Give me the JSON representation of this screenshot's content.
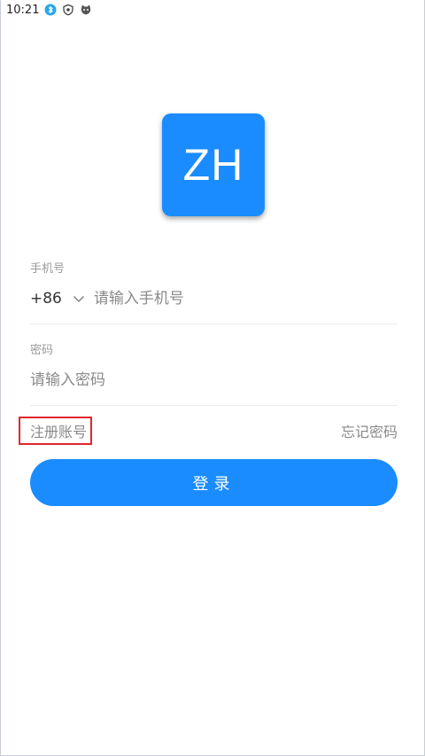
{
  "statusbar": {
    "time": "10:21",
    "icons": [
      "bluetooth-icon",
      "shield-icon",
      "app-cat-icon"
    ]
  },
  "logo": {
    "text": "ZH",
    "color": "#1a8cff"
  },
  "phone": {
    "label": "手机号",
    "country_code": "+86",
    "placeholder": "请输入手机号",
    "value": ""
  },
  "password": {
    "label": "密码",
    "placeholder": "请输入密码",
    "value": ""
  },
  "links": {
    "register": "注册账号",
    "forgot": "忘记密码"
  },
  "login_button": {
    "label": "登录",
    "color": "#1a8cff"
  }
}
